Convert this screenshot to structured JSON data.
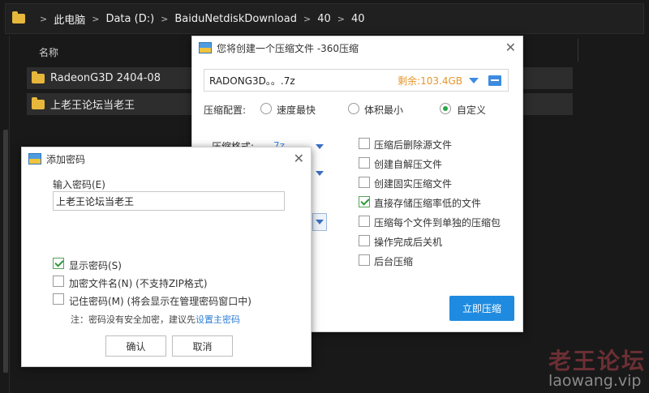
{
  "explorer": {
    "breadcrumb": [
      "此电脑",
      "Data (D:)",
      "BaiduNetdiskDownload",
      "40",
      "40"
    ],
    "column_name": "名称",
    "items": [
      "RadeonG3D 2404-08",
      "上老王论坛当老王"
    ]
  },
  "compress_dialog": {
    "title": "您将创建一个压缩文件 -360压缩",
    "filename": "RADONG3D。。.7z",
    "remaining": "剩余:103.4GB",
    "config_label": "压缩配置:",
    "radio_options": [
      "速度最快",
      "体积最小",
      "自定义"
    ],
    "selected_radio": "自定义",
    "format_label": "压缩格式:",
    "format_value": "7z",
    "options": [
      {
        "label": "压缩后删除源文件",
        "checked": false
      },
      {
        "label": "创建自解压文件",
        "checked": false
      },
      {
        "label": "创建固实压缩文件",
        "checked": false
      },
      {
        "label": "直接存储压缩率低的文件",
        "checked": true
      },
      {
        "label": "压缩每个文件到单独的压缩包",
        "checked": false
      },
      {
        "label": "操作完成后关机",
        "checked": false
      },
      {
        "label": "后台压缩",
        "checked": false
      }
    ],
    "compress_button": "立即压缩"
  },
  "password_dialog": {
    "title": "添加密码",
    "input_label": "输入密码(E)",
    "password_value": "上老王论坛当老王",
    "show_password": "显示密码(S)",
    "encrypt_names": "加密文件名(N) (不支持ZIP格式)",
    "remember": "记住密码(M) (将会显示在管理密码窗口中)",
    "note_prefix": "注：密码没有安全加密，建议先",
    "note_link": "设置主密码",
    "ok": "确认",
    "cancel": "取消"
  },
  "watermark": {
    "title": "老王论坛",
    "url": "laowang.vip"
  }
}
